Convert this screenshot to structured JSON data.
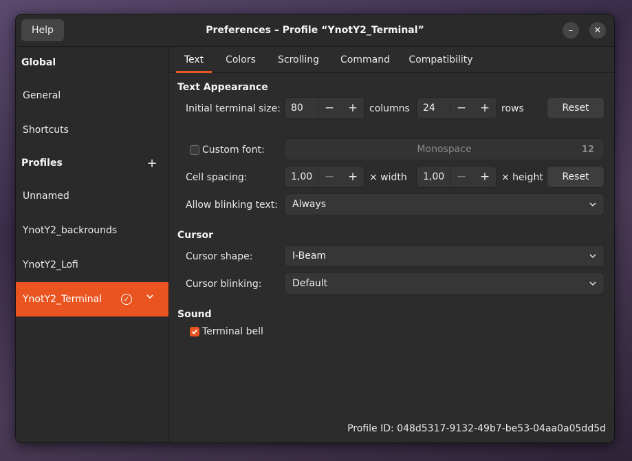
{
  "window": {
    "title": "Preferences – Profile “YnotY2_Terminal”",
    "help_label": "Help",
    "minimize_icon": "minimize-icon",
    "close_icon": "close-icon"
  },
  "sidebar": {
    "global_header": "Global",
    "global_items": [
      {
        "label": "General"
      },
      {
        "label": "Shortcuts"
      }
    ],
    "profiles_header": "Profiles",
    "add_icon": "plus-icon",
    "profiles": [
      {
        "label": "Unnamed"
      },
      {
        "label": "YnotY2_backrounds"
      },
      {
        "label": "YnotY2_Lofi"
      },
      {
        "label": "YnotY2_Terminal",
        "active": true,
        "default_icon": "check-circle-icon",
        "menu_icon": "chevron-down-icon"
      }
    ]
  },
  "tabs": [
    {
      "label": "Text",
      "active": true
    },
    {
      "label": "Colors"
    },
    {
      "label": "Scrolling"
    },
    {
      "label": "Command"
    },
    {
      "label": "Compatibility"
    }
  ],
  "text_appearance": {
    "header": "Text Appearance",
    "initial_size_label": "Initial terminal size:",
    "columns_value": "80",
    "columns_label": "columns",
    "rows_value": "24",
    "rows_label": "rows",
    "size_reset_label": "Reset",
    "custom_font_label": "Custom font:",
    "custom_font_checked": false,
    "font_name": "Monospace",
    "font_size": "12",
    "cell_spacing_label": "Cell spacing:",
    "width_value": "1,00",
    "width_label": "× width",
    "height_value": "1,00",
    "height_label": "× height",
    "spacing_reset_label": "Reset",
    "blink_label": "Allow blinking text:",
    "blink_value": "Always"
  },
  "cursor": {
    "header": "Cursor",
    "shape_label": "Cursor shape:",
    "shape_value": "I-Beam",
    "blinking_label": "Cursor blinking:",
    "blinking_value": "Default"
  },
  "sound": {
    "header": "Sound",
    "bell_label": "Terminal bell",
    "bell_checked": true
  },
  "profile_id": {
    "label": "Profile ID:",
    "value": "048d5317-9132-49b7-be53-04aa0a05dd5d"
  },
  "colors": {
    "accent": "#e95420",
    "window_bg": "#2c2c2c",
    "sidebar_bg": "#2a2a2a"
  },
  "glyphs": {
    "minus": "−",
    "plus": "+",
    "close": "✕",
    "minimize": "–"
  }
}
